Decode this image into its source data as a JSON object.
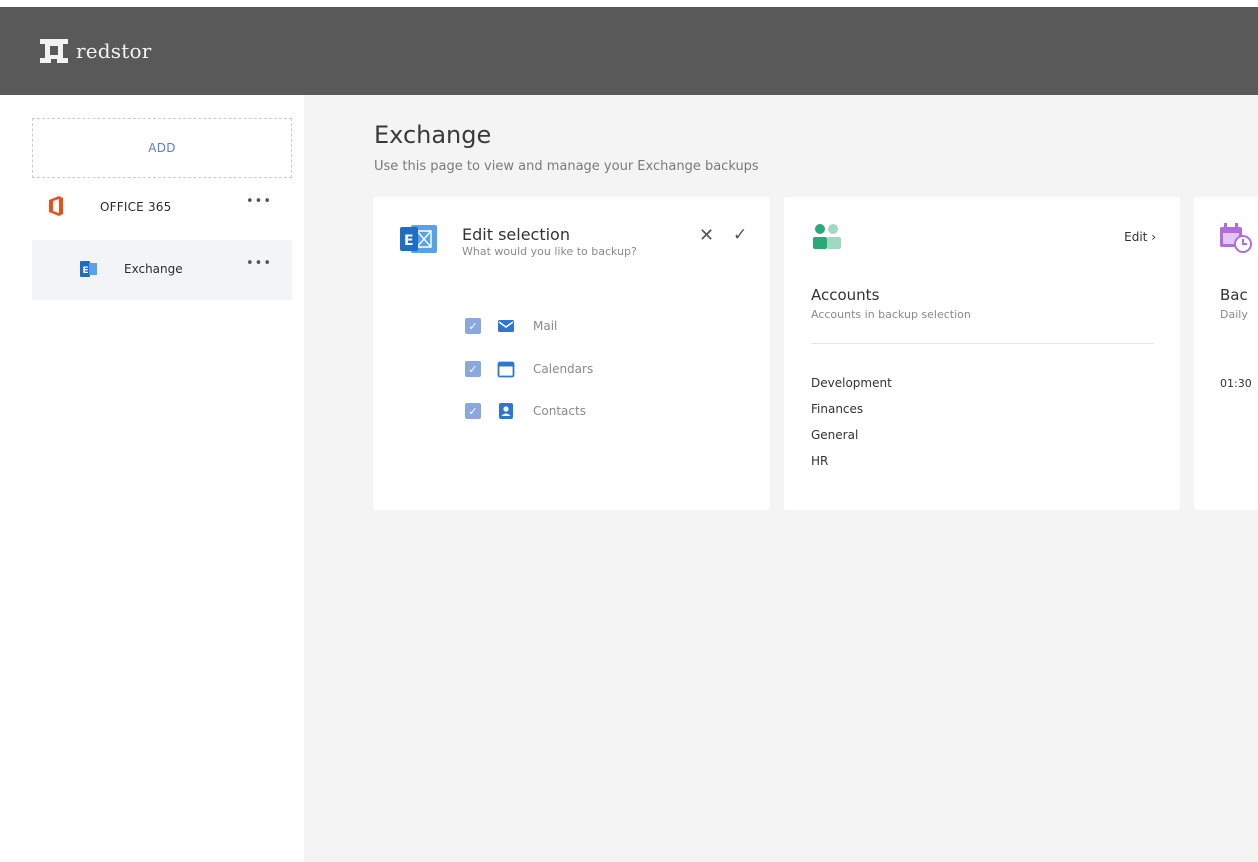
{
  "header": {
    "logo_text": "redstor"
  },
  "sidebar": {
    "add_label": "ADD",
    "items": [
      {
        "label": "OFFICE 365",
        "icon": "office-365-icon",
        "more": "•••"
      },
      {
        "label": "Exchange",
        "icon": "exchange-icon",
        "more": "•••"
      }
    ]
  },
  "main": {
    "title": "Exchange",
    "subtitle": "Use this page to view and manage your Exchange backups"
  },
  "edit_card": {
    "title": "Edit selection",
    "subtitle": "What would you like to backup?",
    "close_glyph": "✕",
    "confirm_glyph": "✓",
    "options": [
      {
        "label": "Mail",
        "icon": "mail-icon",
        "checked": true
      },
      {
        "label": "Calendars",
        "icon": "calendar-icon",
        "checked": true
      },
      {
        "label": "Contacts",
        "icon": "contact-icon",
        "checked": true
      }
    ]
  },
  "accounts_card": {
    "edit_label": "Edit ›",
    "title": "Accounts",
    "subtitle": "Accounts in backup selection",
    "accounts": [
      "Development",
      "Finances",
      "General",
      "HR"
    ]
  },
  "backup_card": {
    "title": "Bac",
    "subtitle": "Daily",
    "time": "01:30"
  },
  "colors": {
    "header_bg": "#595959",
    "accent_blue": "#5b7fc5",
    "checkbox": "#8aa7de",
    "office_orange": "#e8501c",
    "accounts_green": "#2aa877",
    "calendar_purple": "#b06fd8"
  }
}
